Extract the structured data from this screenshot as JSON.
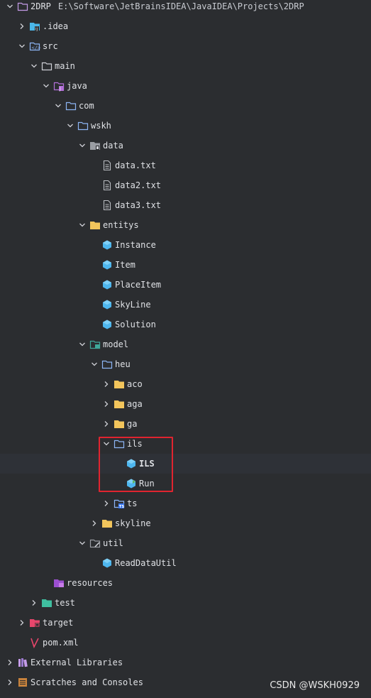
{
  "project": {
    "name": "2DRP",
    "path": "E:\\Software\\JetBrainsIDEA\\JavaIDEA\\Projects\\2DRP"
  },
  "tree": [
    {
      "label": "2DRP",
      "icon": "project-folder-icon",
      "depth": 0,
      "state": "expanded"
    },
    {
      "label": ".idea",
      "icon": "idea-folder-icon",
      "depth": 1,
      "state": "collapsed"
    },
    {
      "label": "src",
      "icon": "source-folder-icon",
      "depth": 1,
      "state": "expanded"
    },
    {
      "label": "main",
      "icon": "folder-icon",
      "depth": 2,
      "state": "expanded"
    },
    {
      "label": "java",
      "icon": "java-source-root-icon",
      "depth": 3,
      "state": "expanded"
    },
    {
      "label": "com",
      "icon": "package-icon",
      "depth": 4,
      "state": "expanded"
    },
    {
      "label": "wskh",
      "icon": "package-icon",
      "depth": 5,
      "state": "expanded"
    },
    {
      "label": "data",
      "icon": "resource-package-icon",
      "depth": 6,
      "state": "expanded"
    },
    {
      "label": "data.txt",
      "icon": "text-file-icon",
      "depth": 7,
      "state": "leaf"
    },
    {
      "label": "data2.txt",
      "icon": "text-file-icon",
      "depth": 7,
      "state": "leaf"
    },
    {
      "label": "data3.txt",
      "icon": "text-file-icon",
      "depth": 7,
      "state": "leaf"
    },
    {
      "label": "entitys",
      "icon": "entity-package-icon",
      "depth": 6,
      "state": "expanded"
    },
    {
      "label": "Instance",
      "icon": "java-class-icon",
      "depth": 7,
      "state": "leaf"
    },
    {
      "label": "Item",
      "icon": "java-class-icon",
      "depth": 7,
      "state": "leaf"
    },
    {
      "label": "PlaceItem",
      "icon": "java-class-icon",
      "depth": 7,
      "state": "leaf"
    },
    {
      "label": "SkyLine",
      "icon": "java-class-icon",
      "depth": 7,
      "state": "leaf"
    },
    {
      "label": "Solution",
      "icon": "java-class-icon",
      "depth": 7,
      "state": "leaf"
    },
    {
      "label": "model",
      "icon": "model-package-icon",
      "depth": 6,
      "state": "expanded"
    },
    {
      "label": "heu",
      "icon": "package-icon",
      "depth": 7,
      "state": "expanded"
    },
    {
      "label": "aco",
      "icon": "yellow-package-icon",
      "depth": 8,
      "state": "collapsed"
    },
    {
      "label": "aga",
      "icon": "yellow-package-icon",
      "depth": 8,
      "state": "collapsed"
    },
    {
      "label": "ga",
      "icon": "yellow-package-icon",
      "depth": 8,
      "state": "collapsed"
    },
    {
      "label": "ils",
      "icon": "package-icon",
      "depth": 8,
      "state": "expanded"
    },
    {
      "label": "ILS",
      "icon": "java-class-icon",
      "depth": 9,
      "state": "leaf",
      "bold": true,
      "selected": true
    },
    {
      "label": "Run",
      "icon": "java-main-class-icon",
      "depth": 9,
      "state": "leaf"
    },
    {
      "label": "ts",
      "icon": "ts-package-icon",
      "depth": 8,
      "state": "collapsed"
    },
    {
      "label": "skyline",
      "icon": "yellow-package-icon",
      "depth": 7,
      "state": "collapsed"
    },
    {
      "label": "util",
      "icon": "util-package-icon",
      "depth": 6,
      "state": "expanded"
    },
    {
      "label": "ReadDataUtil",
      "icon": "java-class-icon",
      "depth": 7,
      "state": "leaf"
    },
    {
      "label": "resources",
      "icon": "resources-root-icon",
      "depth": 3,
      "state": "leaf"
    },
    {
      "label": "test",
      "icon": "test-root-icon",
      "depth": 2,
      "state": "collapsed"
    },
    {
      "label": "target",
      "icon": "excluded-folder-icon",
      "depth": 1,
      "state": "collapsed"
    },
    {
      "label": "pom.xml",
      "icon": "maven-icon",
      "depth": 1,
      "state": "leaf"
    },
    {
      "label": "External Libraries",
      "icon": "libraries-icon",
      "depth": 0,
      "state": "collapsed"
    },
    {
      "label": "Scratches and Consoles",
      "icon": "scratches-icon",
      "depth": 0,
      "state": "collapsed"
    }
  ],
  "watermark": "CSDN @WSKH0929",
  "colors": {
    "background": "#2b2d30",
    "folder_blue": "#8db6f5",
    "package_yellow": "#f2c55c",
    "class_cyan": "#4eb7ef",
    "highlight_red": "#e0242f"
  }
}
